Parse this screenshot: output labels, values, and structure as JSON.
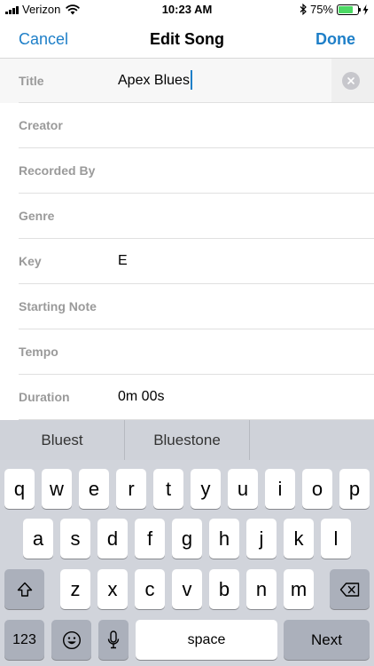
{
  "status_bar": {
    "carrier": "Verizon",
    "time": "10:23 AM",
    "battery_percent": "75%",
    "battery_level": 0.75,
    "icons": [
      "signal-bars-icon",
      "wifi-icon",
      "bluetooth-icon",
      "battery-icon",
      "charging-bolt-icon"
    ]
  },
  "nav": {
    "cancel_label": "Cancel",
    "title": "Edit Song",
    "done_label": "Done",
    "accent_color": "#1e7fc8"
  },
  "form": {
    "title_label": "Title",
    "title_value": "Apex Blues",
    "creator_label": "Creator",
    "recorded_by_label": "Recorded By",
    "genre_label": "Genre",
    "key_label": "Key",
    "key_value": "E",
    "starting_note_label": "Starting Note",
    "tempo_label": "Tempo",
    "duration_label": "Duration",
    "duration_value": "0m 00s"
  },
  "keyboard": {
    "suggestions": [
      "Bluest",
      "Bluestone",
      ""
    ],
    "row1": [
      "q",
      "w",
      "e",
      "r",
      "t",
      "y",
      "u",
      "i",
      "o",
      "p"
    ],
    "row2": [
      "a",
      "s",
      "d",
      "f",
      "g",
      "h",
      "j",
      "k",
      "l"
    ],
    "row3": [
      "z",
      "x",
      "c",
      "v",
      "b",
      "n",
      "m"
    ],
    "numbers_label": "123",
    "space_label": "space",
    "next_label": "Next",
    "icons": [
      "shift-icon",
      "backspace-icon",
      "emoji-icon",
      "microphone-icon"
    ]
  }
}
